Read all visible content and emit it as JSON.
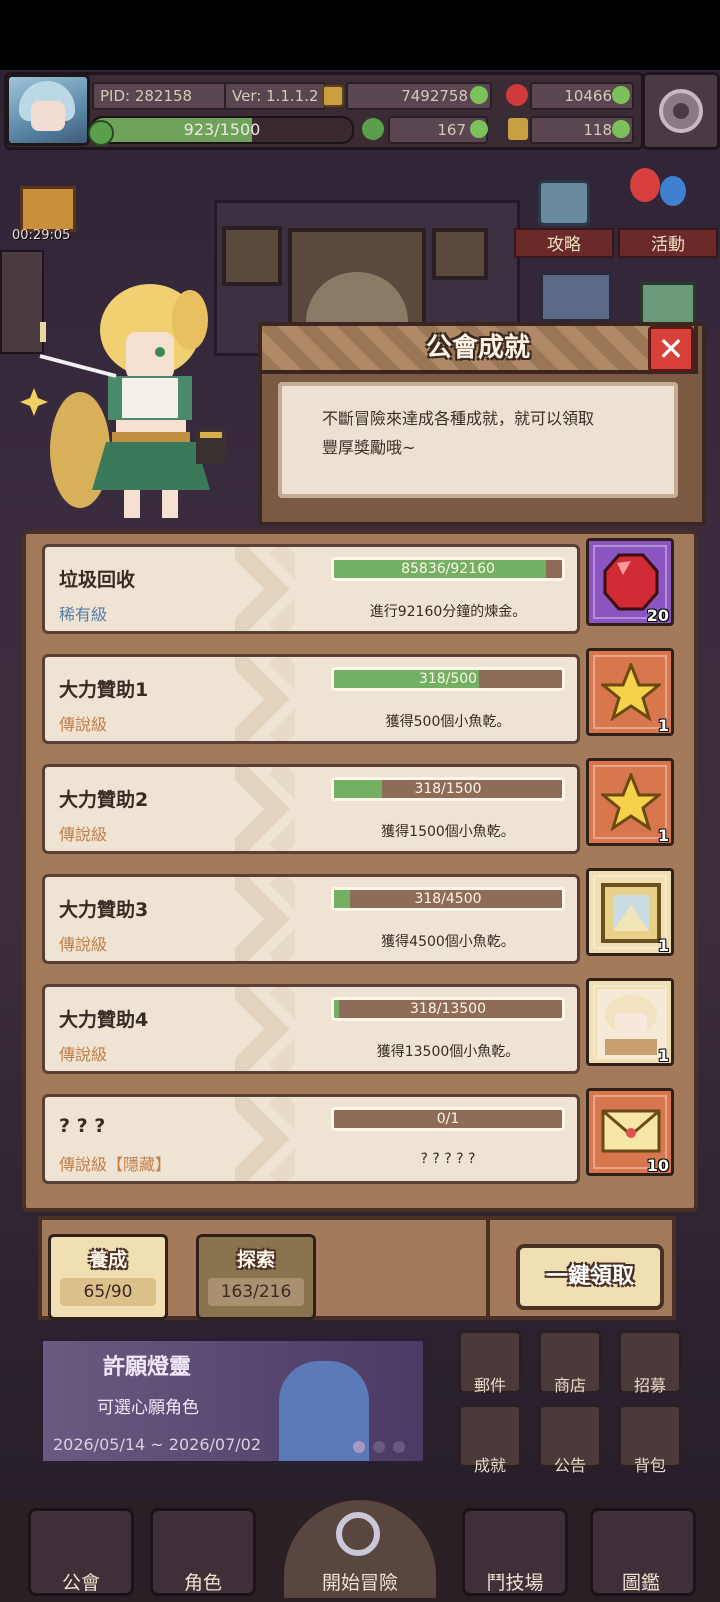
{
  "status": {
    "pid": "PID: 282158",
    "version": "Ver: 1.1.1.2",
    "gold": "7492758",
    "gems": "10466",
    "clovers": "167",
    "keys": "118",
    "xp": "923/1500",
    "xp_fraction": 0.615,
    "timer": "00:29:05"
  },
  "side_buttons": {
    "guide": "攻略",
    "event": "活動"
  },
  "dialog": {
    "title": "公會成就",
    "description_line1": "不斷冒險來達成各種成就，就可以領取",
    "description_line2": "豐厚獎勵哦~",
    "close_icon": "close-icon"
  },
  "achievements": [
    {
      "name": "垃圾回收",
      "rarity": "稀有級",
      "rarity_color": "#5a7ea8",
      "progress": "85836/92160",
      "fraction": 0.931,
      "goal": "進行92160分鐘的煉金。",
      "reward_icon": "red-gem-icon",
      "reward_bg": "#8a55c0",
      "reward_count": "20"
    },
    {
      "name": "大力贊助1",
      "rarity": "傳說級",
      "rarity_color": "#c28048",
      "progress": "318/500",
      "fraction": 0.636,
      "goal": "獲得500個小魚乾。",
      "reward_icon": "star-icon",
      "reward_bg": "#d8764e",
      "reward_count": "1"
    },
    {
      "name": "大力贊助2",
      "rarity": "傳說級",
      "rarity_color": "#c28048",
      "progress": "318/1500",
      "fraction": 0.212,
      "goal": "獲得1500個小魚乾。",
      "reward_icon": "star-icon",
      "reward_bg": "#d8764e",
      "reward_count": "1"
    },
    {
      "name": "大力贊助3",
      "rarity": "傳說級",
      "rarity_color": "#c28048",
      "progress": "318/4500",
      "fraction": 0.071,
      "goal": "獲得4500個小魚乾。",
      "reward_icon": "frame-icon",
      "reward_bg": "#f1dfb4",
      "reward_count": "1"
    },
    {
      "name": "大力贊助4",
      "rarity": "傳說級",
      "rarity_color": "#c28048",
      "progress": "318/13500",
      "fraction": 0.024,
      "goal": "獲得13500個小魚乾。",
      "reward_icon": "character-portrait-icon",
      "reward_bg": "#f1dfb4",
      "reward_count": "1"
    },
    {
      "name": "? ? ?",
      "rarity": "傳說級【隱藏】",
      "rarity_color": "#c28048",
      "progress": "0/1",
      "fraction": 0,
      "goal": "? ? ? ? ?",
      "reward_icon": "letter-icon",
      "reward_bg": "#d8764e",
      "reward_count": "10"
    }
  ],
  "tabs": [
    {
      "label": "養成",
      "value": "65/90"
    },
    {
      "label": "探索",
      "value": "163/216"
    }
  ],
  "claim_all": "一鍵領取",
  "banner": {
    "title": "許願燈靈",
    "subtitle": "可選心願角色",
    "dates": "2026/05/14 ~ 2026/07/02"
  },
  "menu": [
    "郵件",
    "商店",
    "招募",
    "成就",
    "公告",
    "背包"
  ],
  "nav": [
    "公會",
    "角色",
    "開始冒險",
    "鬥技場",
    "圖鑑"
  ]
}
